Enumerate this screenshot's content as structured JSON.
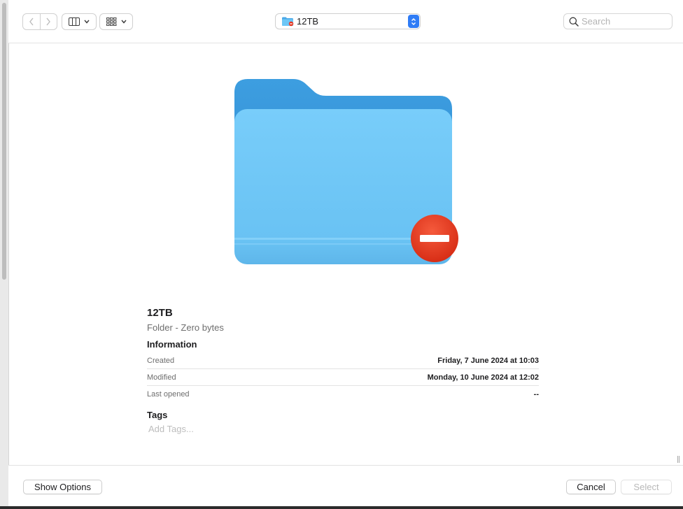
{
  "toolbar": {
    "back_icon": "chevron-left-icon",
    "forward_icon": "chevron-right-icon",
    "view_column_icon": "column-view-icon",
    "group_icon": "grid-group-icon",
    "path_label": "12TB",
    "search_placeholder": "Search"
  },
  "preview": {
    "icon": "folder-icon",
    "badge_icon": "no-entry-badge-icon",
    "name": "12TB",
    "kind": "Folder - Zero bytes"
  },
  "info": {
    "heading": "Information",
    "rows": [
      {
        "label": "Created",
        "value": "Friday, 7 June 2024 at 10:03"
      },
      {
        "label": "Modified",
        "value": "Monday, 10 June 2024 at 12:02"
      },
      {
        "label": "Last opened",
        "value": "--"
      }
    ]
  },
  "tags": {
    "heading": "Tags",
    "placeholder": "Add Tags..."
  },
  "footer": {
    "show_options": "Show Options",
    "cancel": "Cancel",
    "select": "Select"
  },
  "colors": {
    "accent": "#2f7cf6",
    "folder_front": "#6cc6f6",
    "folder_back": "#3b9ee0",
    "badge_red": "#e8321c"
  }
}
